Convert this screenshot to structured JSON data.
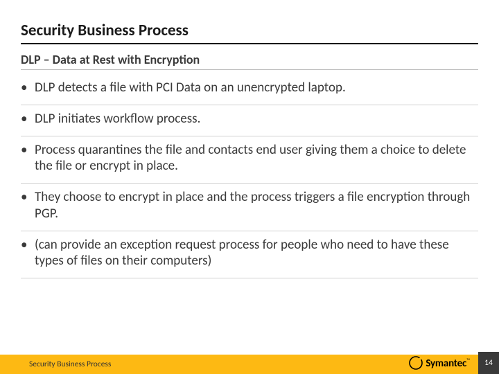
{
  "title": "Security Business Process",
  "subtitle": "DLP – Data at Rest with Encryption",
  "bullets": [
    "DLP detects a file with PCI Data on an unencrypted laptop.",
    "DLP initiates workflow process.",
    "Process quarantines the file and contacts end user giving them a choice to delete the file or encrypt in place.",
    "They choose to encrypt in place and the process triggers a file encryption through PGP.",
    "(can provide an exception request process for people who need to have these types of files on their computers)"
  ],
  "footer": {
    "text": "Security Business Process",
    "page": "14"
  },
  "brand": {
    "name": "Symantec",
    "tm": "™"
  }
}
